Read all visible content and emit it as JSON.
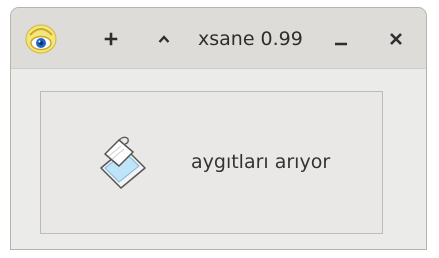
{
  "window": {
    "title": "xsane 0.99",
    "icons": {
      "app": "xsane-eye-icon",
      "plus": "plus-icon",
      "up": "chevron-up-icon",
      "minimize": "minimize-icon",
      "close": "close-icon",
      "scanner": "scanner-icon"
    }
  },
  "content": {
    "status_text": "aygıtları arıyor"
  },
  "colors": {
    "titlebar": "#dedcd9",
    "window_bg": "#ebebea",
    "accent_blue": "#1f66c7",
    "accent_yellow": "#f3df5a"
  }
}
